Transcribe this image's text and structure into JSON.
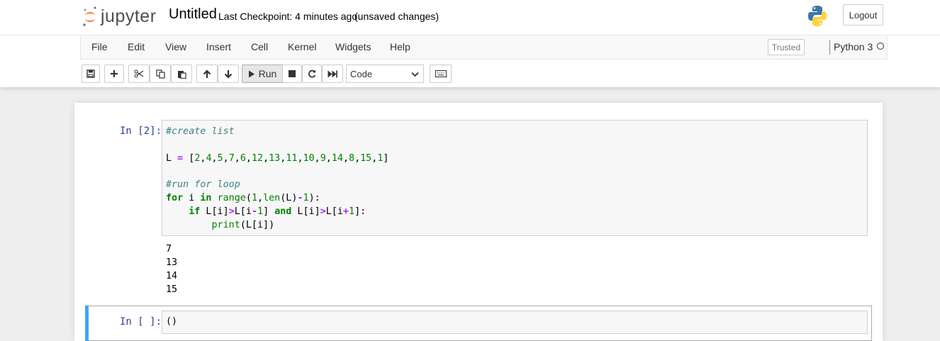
{
  "header": {
    "logo_text": "jupyter",
    "notebook_title": "Untitled",
    "checkpoint": "Last Checkpoint: 4 minutes ago",
    "unsaved": "(unsaved changes)",
    "logout_label": "Logout"
  },
  "menu": {
    "items": [
      "File",
      "Edit",
      "View",
      "Insert",
      "Cell",
      "Kernel",
      "Widgets",
      "Help"
    ],
    "trusted": "Trusted",
    "kernel_name": "Python 3"
  },
  "toolbar": {
    "run_label": "Run",
    "cell_type": "Code",
    "buttons": [
      "save-icon",
      "plus-icon",
      "cut-icon",
      "copy-icon",
      "paste-icon",
      "arrow-up-icon",
      "arrow-down-icon",
      "run-icon",
      "stop-icon",
      "restart-icon",
      "fast-forward-icon",
      "keyboard-icon"
    ]
  },
  "cells": [
    {
      "prompt": "In [2]:",
      "source": "#create list\n\nL = [2,4,5,7,6,12,13,11,10,9,14,8,15,1]\n\n#run for loop\nfor i in range(1,len(L)-1):\n    if L[i]>L[i-1] and L[i]>L[i+1]:\n        print(L[i])",
      "outputs": [
        "7",
        "13",
        "14",
        "15"
      ]
    },
    {
      "prompt": "In [ ]:",
      "source": "()"
    }
  ],
  "colors": {
    "prompt": "#303f9f",
    "selected_bar": "#42a5f5",
    "comment": "#408080",
    "keyword": "#008000",
    "operator": "#aa22ff",
    "logo_orange": "#f37726"
  }
}
